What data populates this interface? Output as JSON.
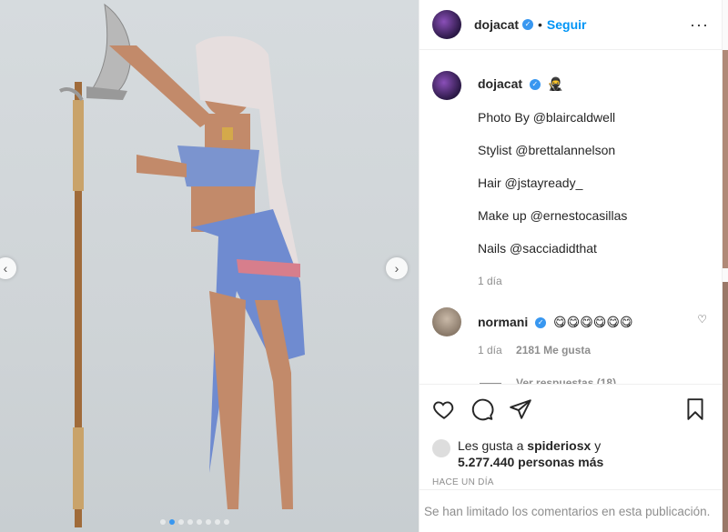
{
  "post": {
    "username": "dojacat",
    "follow_label": "Seguir",
    "more_label": "···",
    "dot_separator": "•",
    "carousel": {
      "slide_count": 8,
      "active_index": 1
    }
  },
  "caption": {
    "username": "dojacat",
    "emoji": "🥷",
    "lines": [
      "Photo By @blaircaldwell",
      "Stylist @brettalannelson",
      "Hair @jstayready_",
      "Make up @ernestocasillas",
      "Nails @sacciadidthat"
    ],
    "time": "1 día"
  },
  "comment": {
    "username": "normani",
    "text": "😋😋😋😋😋😋",
    "time": "1 día",
    "likes": "2181 Me gusta",
    "replies_label": "Ver respuestas (18)"
  },
  "likes": {
    "prefix": "Les gusta a ",
    "user": "spideriosx",
    "conj": " y",
    "others": "5.277.440 personas más"
  },
  "timestamp": "HACE UN DÍA",
  "comments_limited": "Se han limitado los comentarios en esta publicación.",
  "colors": {
    "accent": "#0095f6",
    "verified": "#3897f0"
  },
  "icons": [
    "heart-icon",
    "comment-icon",
    "share-icon",
    "bookmark-icon"
  ]
}
